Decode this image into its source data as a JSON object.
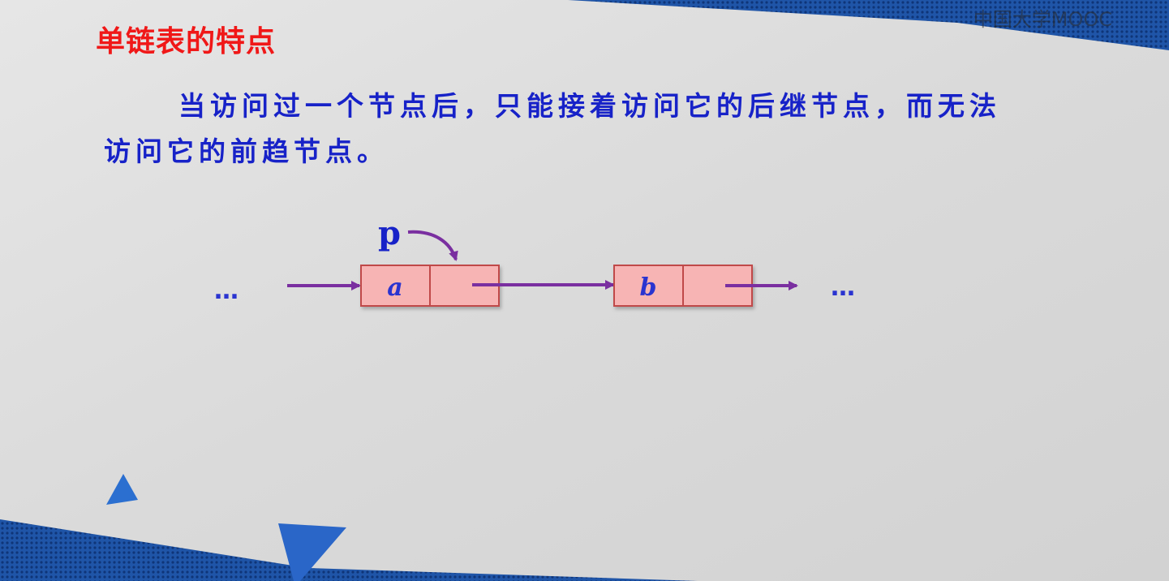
{
  "slide": {
    "title": "单链表的特点",
    "body_line1": "当访问过一个节点后，只能接着访问它的后继节点，而无法",
    "body_line2": "访问它的前趋节点。",
    "watermark": "中国大学MOOC"
  },
  "diagram": {
    "pointer_label": "p",
    "left_ellipsis": "…",
    "right_ellipsis": "…",
    "nodes": [
      {
        "data": "a"
      },
      {
        "data": "b"
      }
    ]
  },
  "colors": {
    "title": "#f01818",
    "body_text": "#1722c8",
    "arrow": "#7a2fa0",
    "node_fill": "#f7b4b4",
    "node_border": "#c04848",
    "paper": "#dcdcdc",
    "frame": "#1d4f9f"
  }
}
